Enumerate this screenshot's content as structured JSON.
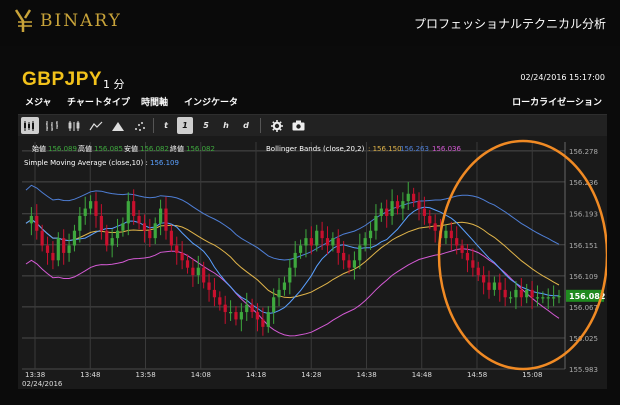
{
  "brand": {
    "name": "BINARY",
    "tagline": "プロフェッショナルテクニカル分析"
  },
  "instrument": {
    "symbol": "GBPJPY",
    "interval": "1 分",
    "timestamp": "02/24/2016 15:17:00"
  },
  "menu": {
    "items": [
      "メジャ",
      "チャートタイプ",
      "時間軸",
      "インジケータ"
    ],
    "localize": "ローカライゼーション"
  },
  "toolbar": {
    "timeframes": [
      "t",
      "1",
      "5",
      "h",
      "d"
    ],
    "active_timeframe": "1"
  },
  "chart_data": {
    "type": "candlestick",
    "ohlc_labels": [
      "始値",
      "高値",
      "安値",
      "終値"
    ],
    "ohlc_values": [
      "156.089",
      "156.085",
      "156.082",
      "156.082"
    ],
    "indicator_bb": "Bollinger Bands (close,20,2)",
    "indicator_bb_values": [
      "156.150",
      "156.263",
      "156.036"
    ],
    "indicator_sma": "Simple Moving Average (close,10)",
    "indicator_sma_value": "156.109",
    "yaxis_ticks": [
      "156.278",
      "156.236",
      "156.193",
      "156.151",
      "156.109",
      "156.067",
      "156.025",
      "155.983"
    ],
    "xaxis_ticks": [
      "13:38",
      "13:48",
      "13:58",
      "14:08",
      "14:18",
      "14:28",
      "14:38",
      "14:48",
      "14:58",
      "15:08"
    ],
    "date_label": "02/24/2016",
    "last_price": "156.082",
    "colors": {
      "up": "#3ea83e",
      "down": "#c8102e",
      "bb_upper": "#4f7fd6",
      "bb_middle": "#e0b44a",
      "bb_lower": "#d45ad4",
      "sma": "#5aa0ff",
      "highlight": "#f08a24"
    },
    "ylim": [
      155.983,
      156.29
    ]
  }
}
